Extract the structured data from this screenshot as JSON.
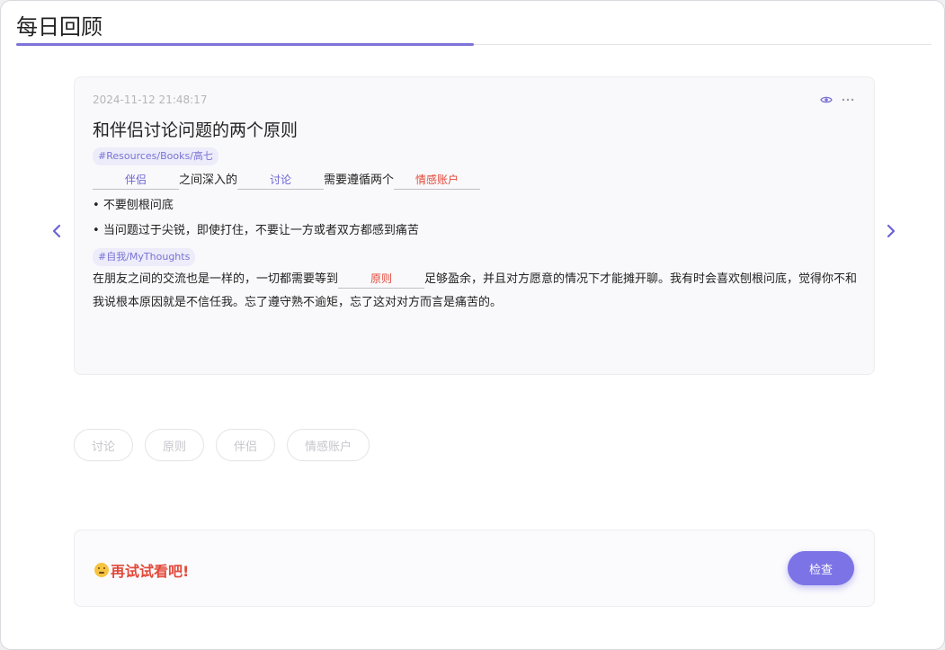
{
  "page": {
    "title": "每日回顾"
  },
  "card": {
    "timestamp": "2024-11-12 21:48:17",
    "title": "和伴侣讨论问题的两个原则",
    "tag1": "#Resources/Books/高七",
    "sentence": {
      "blank1": "伴侣",
      "text1": "之间深入的",
      "blank2": "讨论",
      "text2": "需要遵循两个",
      "blank3": "情感账户"
    },
    "bullets": [
      "不要刨根问底",
      "当问题过于尖锐，即使打住，不要让一方或者双方都感到痛苦"
    ],
    "tag2": "#自我/MyThoughts",
    "para": {
      "text1": "在朋友之间的交流也是一样的，一切都需要等到",
      "blank": "原则",
      "text2": "足够盈余，并且对方愿意的情况下才能摊开聊。我有时会喜欢刨根问底，觉得你不和我说根本原因就是不信任我。忘了遵守熟不逾矩，忘了这对对方而言是痛苦的。"
    }
  },
  "choices": [
    "讨论",
    "原则",
    "伴侣",
    "情感账户"
  ],
  "bottom": {
    "feedback": "再试试看吧!",
    "check_label": "检查"
  },
  "colors": {
    "accent": "#7c73e6",
    "error": "#e2493a"
  }
}
